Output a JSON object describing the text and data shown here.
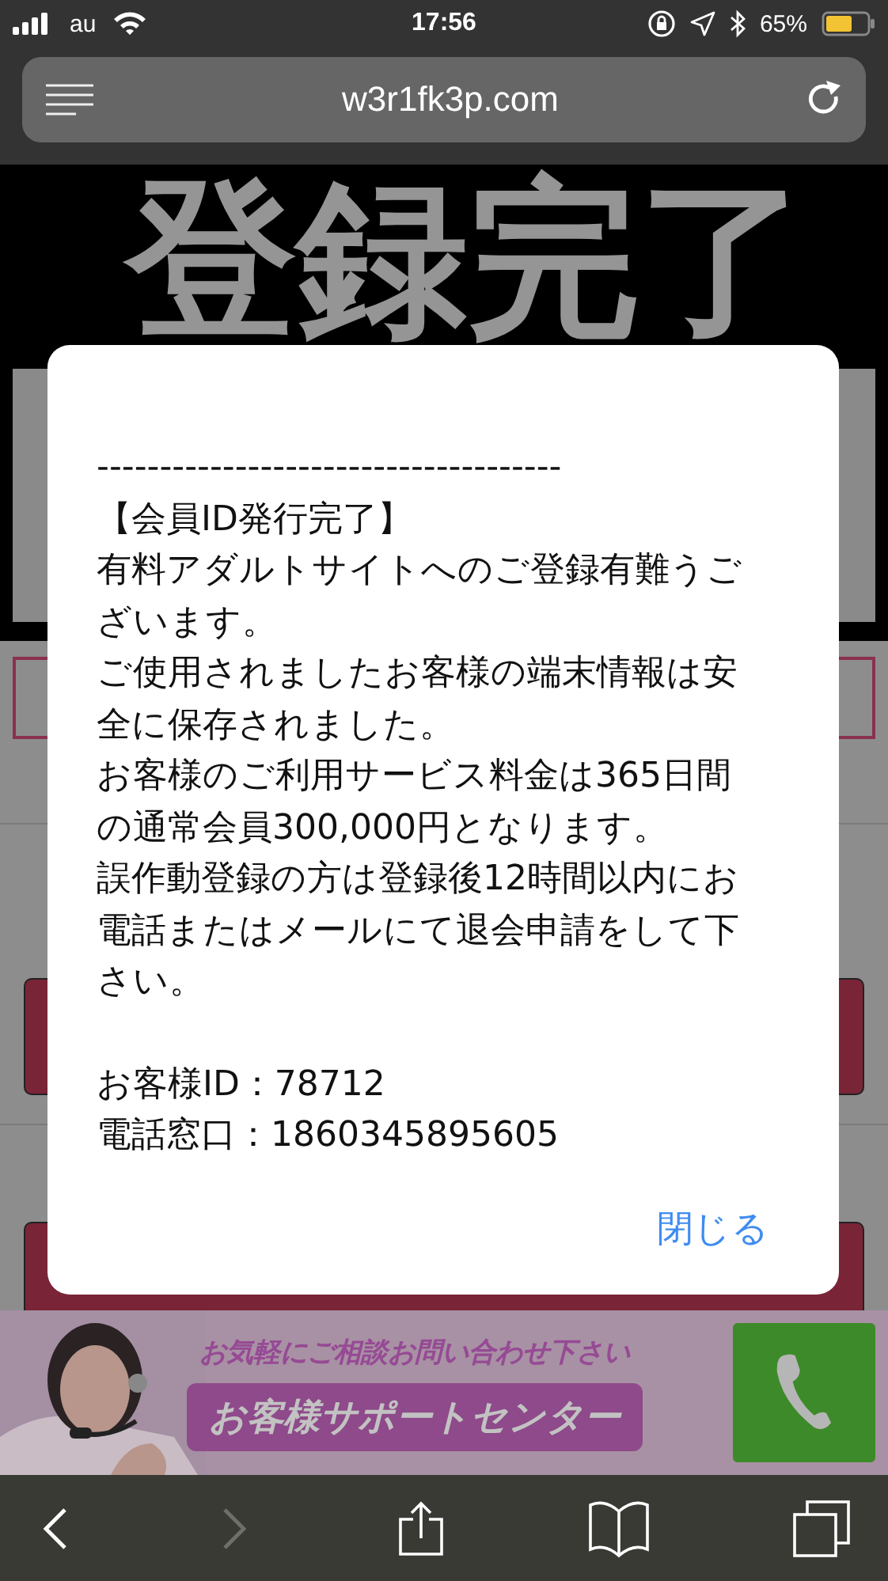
{
  "status_bar": {
    "carrier": "au",
    "time": "17:56",
    "battery": "65%"
  },
  "browser": {
    "url": "w3r1fk3p.com"
  },
  "page": {
    "heading": "登録完了"
  },
  "banner": {
    "tagline": "お気軽にご相談お問い合わせ下さい",
    "label": "お客様サポートセンター"
  },
  "alert": {
    "divider": "-------------------------------------",
    "lines": [
      "【会員ID発行完了】",
      "有料アダルトサイトへのご登録有難うご",
      "ざいます。",
      "ご使用されましたお客様の端末情報は安",
      "全に保存されました。",
      "お客様のご利用サービス料金は365日間",
      "の通常会員300,000円となります。",
      "誤作動登録の方は登録後12時間以内にお",
      "電話またはメールにて退会申請をして下",
      "さい。"
    ],
    "details": [
      "お客様ID：78712",
      "電話窓口：1860345895605"
    ],
    "button": "閉じる"
  },
  "toolbar": [
    {
      "kind": "back",
      "disabled": false
    },
    {
      "kind": "forward",
      "disabled": true
    },
    {
      "kind": "share",
      "disabled": false
    },
    {
      "kind": "bookmarks",
      "disabled": false
    },
    {
      "kind": "tabs",
      "disabled": false
    }
  ]
}
